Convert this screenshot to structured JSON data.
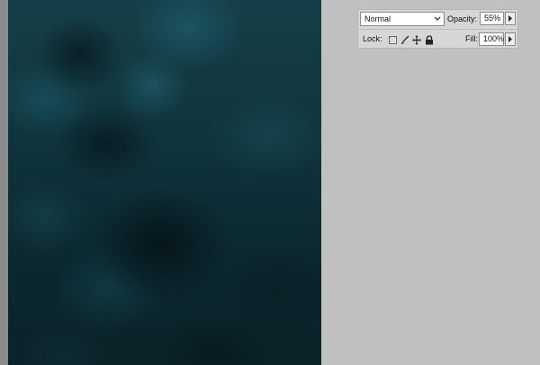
{
  "layers_panel": {
    "blend_mode": "Normal",
    "opacity_label": "Opacity:",
    "opacity_value": "55%",
    "lock_label": "Lock:",
    "fill_label": "Fill:",
    "fill_value": "100%",
    "lock_icons": [
      "lock-transparent-pixels-icon",
      "lock-image-pixels-icon",
      "lock-position-icon",
      "lock-all-icon"
    ]
  },
  "colors": {
    "workspace_bg": "#c0c0c0",
    "canvas_base": "#0e2f36",
    "panel_bg": "#d6d6d6"
  }
}
